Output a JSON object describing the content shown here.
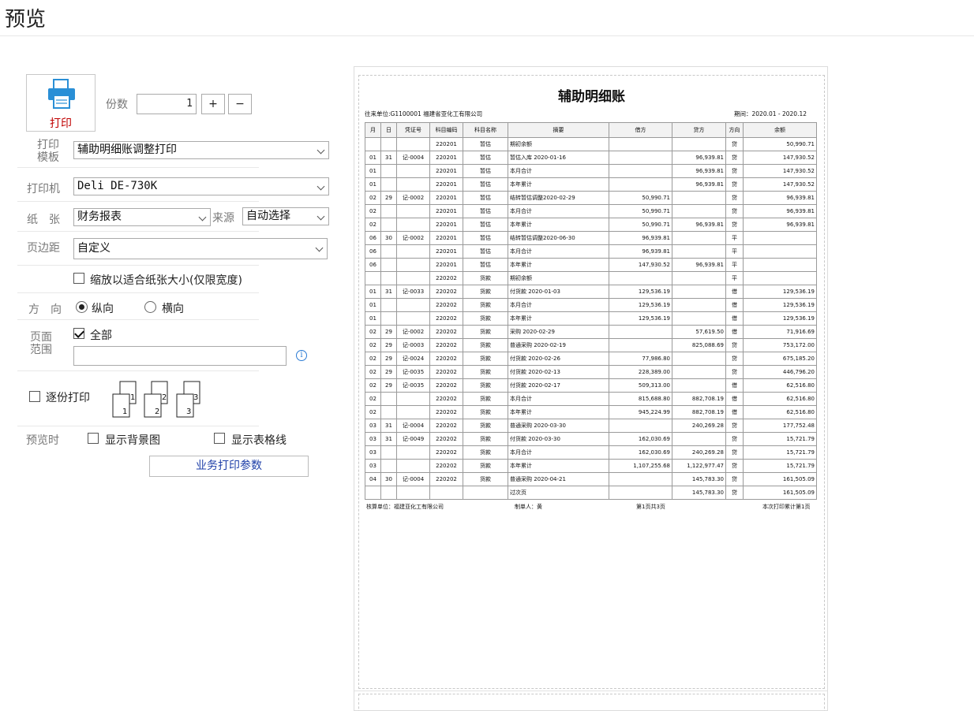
{
  "header": {
    "title": "预览"
  },
  "print_button": {
    "label": "打印"
  },
  "copies": {
    "label": "份数",
    "value": "1",
    "plus": "+",
    "minus": "−"
  },
  "template": {
    "label_line1": "打印",
    "label_line2": "模板",
    "value": "辅助明细账调整打印"
  },
  "printer": {
    "label": "打印机",
    "value": "Deli DE-730K"
  },
  "paper": {
    "label": "纸　张",
    "value": "财务报表",
    "source_label": "来源",
    "source_value": "自动选择"
  },
  "margin": {
    "label": "页边距",
    "value": "自定义"
  },
  "fit_paper": {
    "label": "缩放以适合纸张大小(仅限宽度)",
    "checked": false
  },
  "orientation": {
    "label": "方　向",
    "portrait": "纵向",
    "landscape": "横向",
    "selected": "portrait"
  },
  "page_range": {
    "label_line1": "页面",
    "label_line2": "范围",
    "all_label": "全部",
    "all_checked": true,
    "value": ""
  },
  "collate": {
    "label": "逐份打印",
    "checked": false
  },
  "preview_options": {
    "label": "预览时",
    "show_background": "显示背景图",
    "show_gridlines": "显示表格线"
  },
  "business_params": {
    "label": "业务打印参数"
  },
  "report": {
    "title": "辅助明细账",
    "account_info": "往来单位:G1100001 福建省亚化工有限公司",
    "period": "期间：2020.01 - 2020.12",
    "headers": [
      "月",
      "日",
      "凭证号",
      "科目编码",
      "科目名称",
      "摘要",
      "借方",
      "贷方",
      "方向",
      "余额"
    ],
    "rows": [
      [
        "",
        "",
        "",
        "220201",
        "暂估",
        "期初余额",
        "",
        "",
        "贷",
        "50,990.71"
      ],
      [
        "01",
        "31",
        "记-0004",
        "220201",
        "暂估",
        "暂估入库 2020-01-16",
        "",
        "96,939.81",
        "贷",
        "147,930.52"
      ],
      [
        "01",
        "",
        "",
        "220201",
        "暂估",
        "本月合计",
        "",
        "96,939.81",
        "贷",
        "147,930.52"
      ],
      [
        "01",
        "",
        "",
        "220201",
        "暂估",
        "本年累计",
        "",
        "96,939.81",
        "贷",
        "147,930.52"
      ],
      [
        "02",
        "29",
        "记-0002",
        "220201",
        "暂估",
        "结转暂估调整2020-02-29",
        "50,990.71",
        "",
        "贷",
        "96,939.81"
      ],
      [
        "02",
        "",
        "",
        "220201",
        "暂估",
        "本月合计",
        "50,990.71",
        "",
        "贷",
        "96,939.81"
      ],
      [
        "02",
        "",
        "",
        "220201",
        "暂估",
        "本年累计",
        "50,990.71",
        "96,939.81",
        "贷",
        "96,939.81"
      ],
      [
        "06",
        "30",
        "记-0002",
        "220201",
        "暂估",
        "结转暂估调整2020-06-30",
        "96,939.81",
        "",
        "平",
        ""
      ],
      [
        "06",
        "",
        "",
        "220201",
        "暂估",
        "本月合计",
        "96,939.81",
        "",
        "平",
        ""
      ],
      [
        "06",
        "",
        "",
        "220201",
        "暂估",
        "本年累计",
        "147,930.52",
        "96,939.81",
        "平",
        ""
      ],
      [
        "",
        "",
        "",
        "220202",
        "货款",
        "期初余额",
        "",
        "",
        "平",
        ""
      ],
      [
        "01",
        "31",
        "记-0033",
        "220202",
        "货款",
        "付货款 2020-01-03",
        "129,536.19",
        "",
        "借",
        "129,536.19"
      ],
      [
        "01",
        "",
        "",
        "220202",
        "货款",
        "本月合计",
        "129,536.19",
        "",
        "借",
        "129,536.19"
      ],
      [
        "01",
        "",
        "",
        "220202",
        "货款",
        "本年累计",
        "129,536.19",
        "",
        "借",
        "129,536.19"
      ],
      [
        "02",
        "29",
        "记-0002",
        "220202",
        "货款",
        "采购 2020-02-29",
        "",
        "57,619.50",
        "借",
        "71,916.69"
      ],
      [
        "02",
        "29",
        "记-0003",
        "220202",
        "货款",
        "普通采购 2020-02-19",
        "",
        "825,088.69",
        "贷",
        "753,172.00"
      ],
      [
        "02",
        "29",
        "记-0024",
        "220202",
        "货款",
        "付货款 2020-02-26",
        "77,986.80",
        "",
        "贷",
        "675,185.20"
      ],
      [
        "02",
        "29",
        "记-0035",
        "220202",
        "货款",
        "付货款 2020-02-13",
        "228,389.00",
        "",
        "贷",
        "446,796.20"
      ],
      [
        "02",
        "29",
        "记-0035",
        "220202",
        "货款",
        "付货款 2020-02-17",
        "509,313.00",
        "",
        "借",
        "62,516.80"
      ],
      [
        "02",
        "",
        "",
        "220202",
        "货款",
        "本月合计",
        "815,688.80",
        "882,708.19",
        "借",
        "62,516.80"
      ],
      [
        "02",
        "",
        "",
        "220202",
        "货款",
        "本年累计",
        "945,224.99",
        "882,708.19",
        "借",
        "62,516.80"
      ],
      [
        "03",
        "31",
        "记-0004",
        "220202",
        "货款",
        "普通采购 2020-03-30",
        "",
        "240,269.28",
        "贷",
        "177,752.48"
      ],
      [
        "03",
        "31",
        "记-0049",
        "220202",
        "货款",
        "付货款 2020-03-30",
        "162,030.69",
        "",
        "贷",
        "15,721.79"
      ],
      [
        "03",
        "",
        "",
        "220202",
        "货款",
        "本月合计",
        "162,030.69",
        "240,269.28",
        "贷",
        "15,721.79"
      ],
      [
        "03",
        "",
        "",
        "220202",
        "货款",
        "本年累计",
        "1,107,255.68",
        "1,122,977.47",
        "贷",
        "15,721.79"
      ],
      [
        "04",
        "30",
        "记-0004",
        "220202",
        "货款",
        "普通采购 2020-04-21",
        "",
        "145,783.30",
        "贷",
        "161,505.09"
      ],
      [
        "",
        "",
        "",
        "",
        "",
        "过次页",
        "",
        "145,783.30",
        "贷",
        "161,505.09"
      ]
    ],
    "footer": {
      "unit": "核算单位：福建亚化工有限公司",
      "maker": "制单人：黄",
      "page": "第1页共3页",
      "print_count": "本次打印累计第1页"
    }
  }
}
